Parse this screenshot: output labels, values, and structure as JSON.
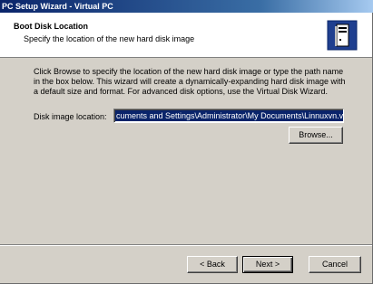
{
  "window": {
    "title": "PC Setup Wizard - Virtual PC"
  },
  "header": {
    "title": "Boot Disk Location",
    "subtitle": "Specify the location of the new hard disk image",
    "icon": "computer-tower-icon"
  },
  "body": {
    "description": "Click Browse to specify the location of the new hard disk image or type the path name in the box below. This wizard will create a dynamically-expanding hard disk image with a default size and format. For advanced disk options, use the Virtual Disk Wizard.",
    "location_label": "Disk image location:",
    "location_value": "cuments and Settings\\Administrator\\My Documents\\Linnuxvn.vhd",
    "browse_label": "Browse..."
  },
  "footer": {
    "back_label": "< Back",
    "next_label": "Next >",
    "cancel_label": "Cancel"
  },
  "colors": {
    "titlebar": "#0a246a",
    "dialog_bg": "#d4d0c8",
    "selection": "#0a246a"
  }
}
